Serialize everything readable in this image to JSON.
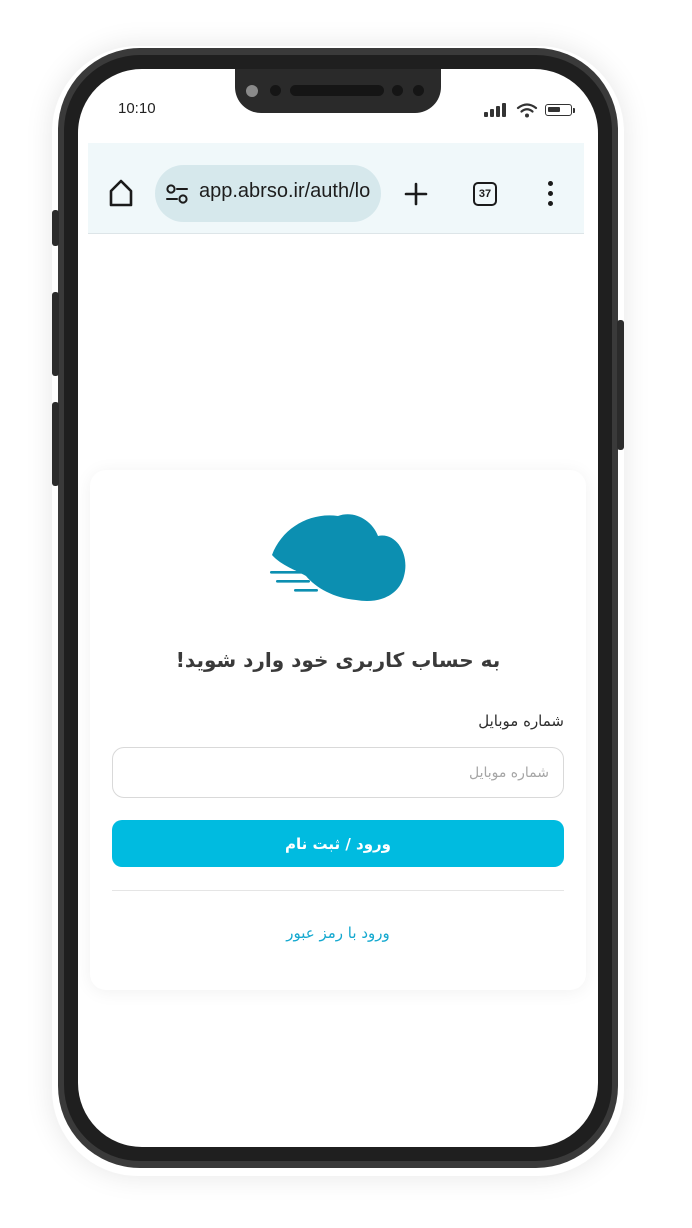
{
  "status_bar": {
    "time": "10:10",
    "battery_level": 0.6
  },
  "browser": {
    "url": "app.abrso.ir/auth/login",
    "tab_count": "37",
    "icons": [
      "home-icon",
      "site-info-icon",
      "new-tab-icon",
      "tab-switcher-icon",
      "overflow-menu-icon"
    ]
  },
  "login": {
    "heading": "به حساب کاربری خود وارد شوید!",
    "mobile_label": "شماره موبایل",
    "mobile_placeholder": "شماره موبایل",
    "mobile_value": "",
    "submit_label": "ورود / ثبت نام",
    "password_login_link": "ورود با رمز عبور"
  },
  "colors": {
    "accent": "#00bbe0",
    "logo": "#0c8fb1",
    "link": "#13a8cf",
    "toolbar_bg": "#f0f8fa",
    "url_pill_bg": "#d6e8ec"
  }
}
